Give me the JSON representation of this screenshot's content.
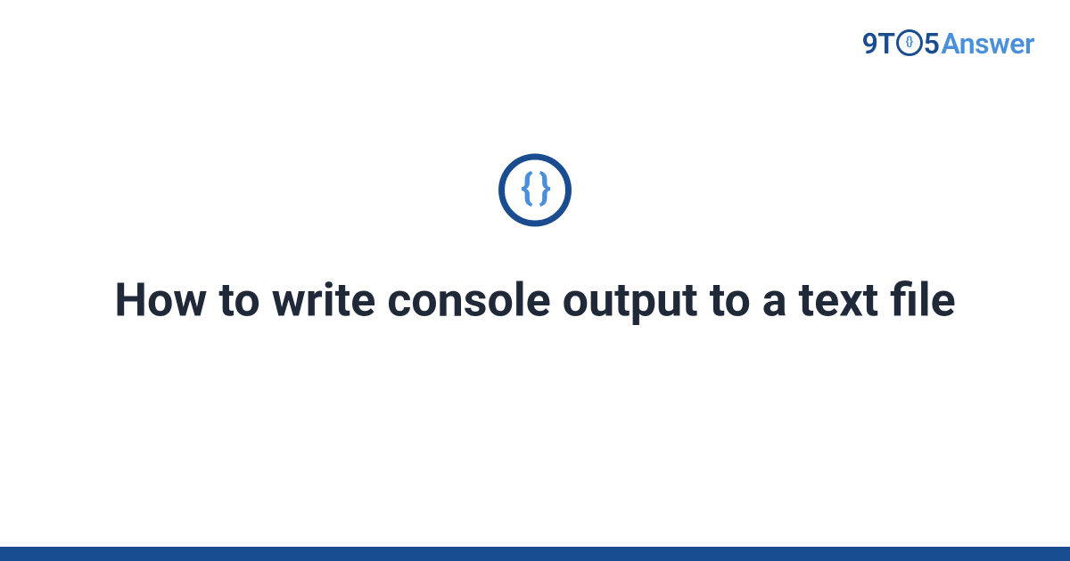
{
  "logo": {
    "part_nine": "9",
    "part_t": "T",
    "part_o_inner": "{}",
    "part_five": "5",
    "part_answer": "Answer"
  },
  "icon": {
    "glyph": "{ }"
  },
  "heading": "How to write console output to a text file",
  "colors": {
    "primary_dark": "#1a4d8f",
    "primary_light": "#4a8fd9",
    "text": "#1f2937"
  }
}
